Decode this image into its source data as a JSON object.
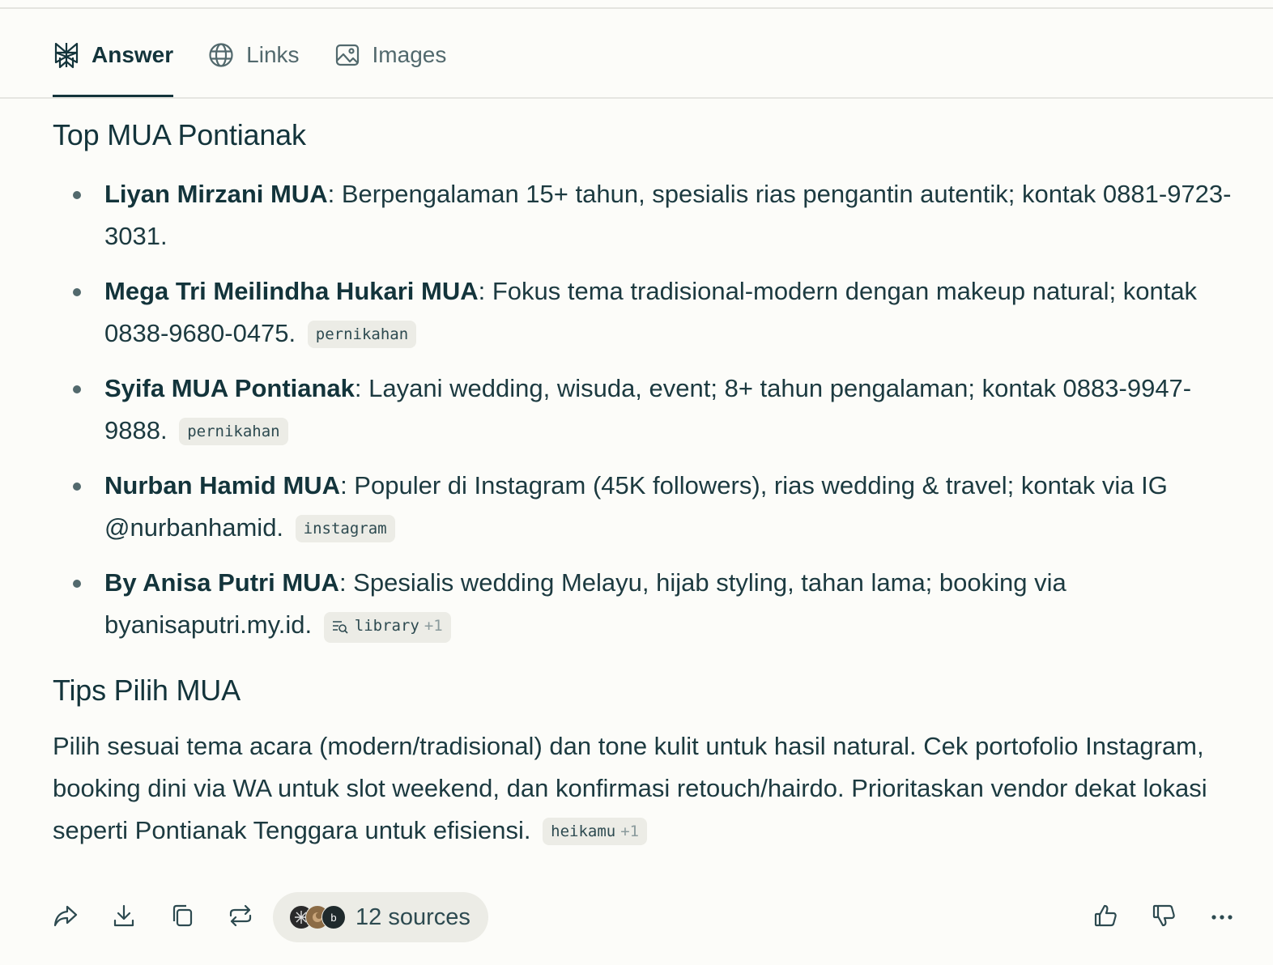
{
  "tabs": [
    {
      "label": "Answer",
      "icon": "perplexity-logo-icon",
      "active": true
    },
    {
      "label": "Links",
      "icon": "globe-icon",
      "active": false
    },
    {
      "label": "Images",
      "icon": "image-icon",
      "active": false
    }
  ],
  "section_top": {
    "title": "Top MUA Pontianak",
    "items": [
      {
        "name": "Liyan Mirzani MUA",
        "text": ": Berpengalaman 15+ tahun, spesialis rias pengantin autentik; kontak 0881-9723-3031."
      },
      {
        "name": "Mega Tri Meilindha Hukari MUA",
        "text": ": Fokus tema tradisional-modern dengan makeup natural; kontak 0838-9680-0475.",
        "cite": "pernikahan"
      },
      {
        "name": "Syifa MUA Pontianak",
        "text": ": Layani wedding, wisuda, event; 8+ tahun pengalaman; kontak 0883-9947-9888.",
        "cite": "pernikahan"
      },
      {
        "name": "Nurban Hamid MUA",
        "text": ": Populer di Instagram (45K followers), rias wedding & travel; kontak via IG @nurbanhamid.",
        "cite": "instagram"
      },
      {
        "name": "By Anisa Putri MUA",
        "text": ": Spesialis wedding Melayu, hijab styling, tahan lama; booking via byanisaputri.my.id.",
        "cite": "library",
        "cite_plus": "+1",
        "cite_icon": "library-search-icon"
      }
    ]
  },
  "section_tips": {
    "title": "Tips Pilih MUA",
    "text": "Pilih sesuai tema acara (modern/tradisional) dan tone kulit untuk hasil natural. Cek portofolio Instagram, booking dini via WA untuk slot weekend, dan konfirmasi retouch/hairdo. Prioritaskan vendor dekat lokasi seperti Pontianak Tenggara untuk efisiensi.",
    "cite": "heikamu",
    "cite_plus": "+1"
  },
  "bottom_bar": {
    "left_actions": [
      "share-icon",
      "download-icon",
      "copy-icon",
      "rewrite-icon"
    ],
    "sources_label": "12 sources",
    "source_avatar_letter": "b",
    "right_actions": [
      "thumbs-up-icon",
      "thumbs-down-icon",
      "more-icon"
    ]
  },
  "colors": {
    "background": "#fcfcf9",
    "text": "#13343b",
    "muted": "#52696d",
    "pill": "#ecece6"
  }
}
